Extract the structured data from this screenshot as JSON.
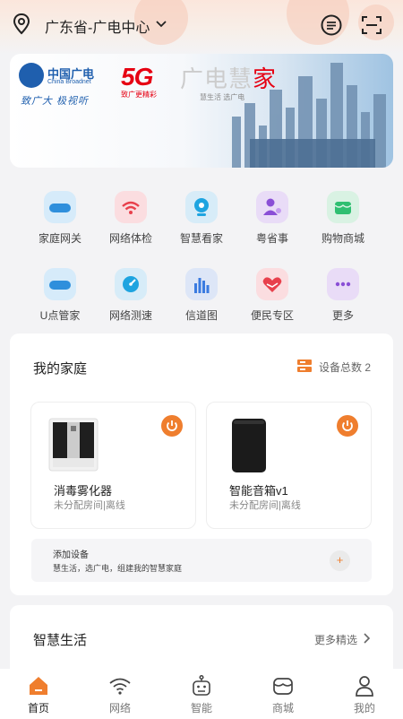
{
  "header": {
    "location": "广东省-广电中心"
  },
  "banner": {
    "cbn_name": "中国广电",
    "cbn_en": "China Broadnet",
    "cbn_slogan": "致广大 极视听",
    "g5": "5G",
    "g5_sub": "致广更精彩",
    "home_prefix": "广电慧",
    "home_suffix": "家",
    "home_sub": "慧生活 选广电"
  },
  "grid": [
    {
      "label": "家庭网关",
      "icon": "gateway-icon",
      "color": "#d6ebfa"
    },
    {
      "label": "网络体检",
      "icon": "wifi-check-icon",
      "color": "#fbdde0"
    },
    {
      "label": "智慧看家",
      "icon": "camera-icon",
      "color": "#d7ecf8"
    },
    {
      "label": "粤省事",
      "icon": "person-icon",
      "color": "#e9dcf7"
    },
    {
      "label": "购物商城",
      "icon": "shop-icon",
      "color": "#d9f2e3"
    },
    {
      "label": "U点管家",
      "icon": "cloud-icon",
      "color": "#d6ebfa"
    },
    {
      "label": "网络测速",
      "icon": "speedometer-icon",
      "color": "#d7ecf8"
    },
    {
      "label": "信道图",
      "icon": "bar-chart-icon",
      "color": "#dde6f7"
    },
    {
      "label": "便民专区",
      "icon": "heart-hands-icon",
      "color": "#fbdde0"
    },
    {
      "label": "更多",
      "icon": "more-icon",
      "color": "#e9dcf7"
    }
  ],
  "family": {
    "title": "我的家庭",
    "device_total": "设备总数 2",
    "devices": [
      {
        "name": "消毒雾化器",
        "status": "未分配房间|离线"
      },
      {
        "name": "智能音箱v1",
        "status": "未分配房间|离线"
      }
    ],
    "add_title": "添加设备",
    "add_sub": "慧生活，选广电，组建我的智慧家庭",
    "add_btn": "+"
  },
  "smart": {
    "title": "智慧生活",
    "more": "更多精选"
  },
  "tabs": [
    {
      "label": "首页",
      "icon": "home-icon",
      "active": true
    },
    {
      "label": "网络",
      "icon": "wifi-icon",
      "active": false
    },
    {
      "label": "智能",
      "icon": "robot-icon",
      "active": false
    },
    {
      "label": "商城",
      "icon": "store-icon",
      "active": false
    },
    {
      "label": "我的",
      "icon": "user-icon",
      "active": false
    }
  ],
  "colors": {
    "accent": "#ef7e2e",
    "brand_blue": "#1f5fae",
    "brand_red": "#e60012"
  }
}
